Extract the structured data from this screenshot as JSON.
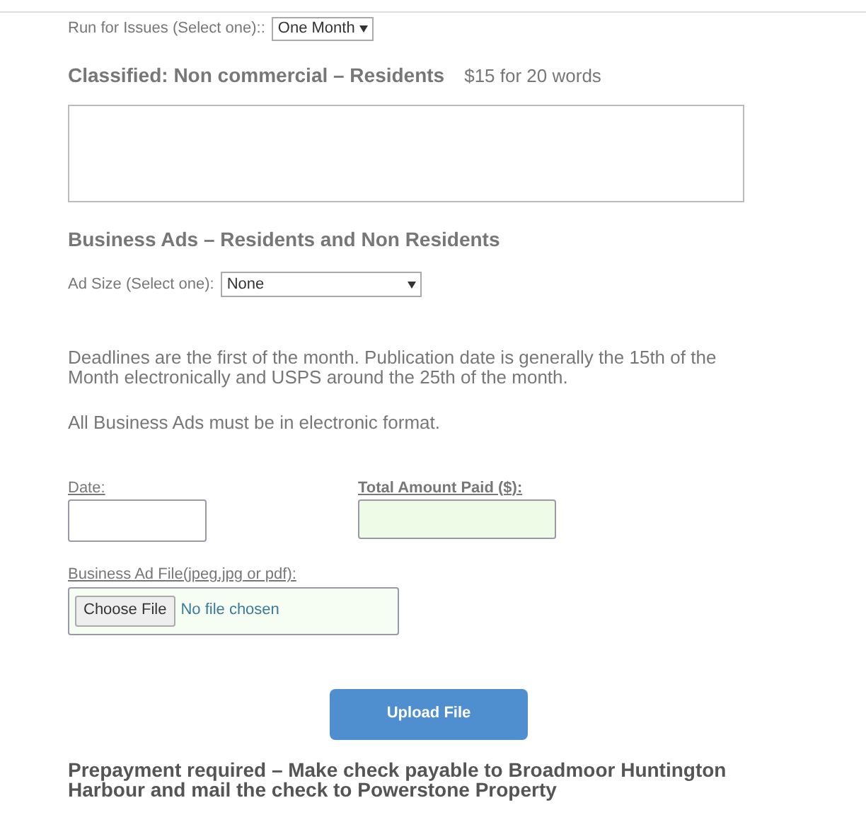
{
  "run_for_issues": {
    "label": "Run for Issues (Select one)::",
    "value": "One Month"
  },
  "classified": {
    "heading": "Classified: Non commercial – Residents",
    "price": "$15 for 20 words"
  },
  "business_ads": {
    "heading": "Business Ads – Residents and Non Residents",
    "ad_size": {
      "label": "Ad Size (Select one):",
      "value": "None"
    }
  },
  "deadline_note": "Deadlines are the first of the month. Publication date is generally the 15th of the Month electronically and USPS around the 25th of the month.",
  "format_note": "All Business Ads must be in electronic format.",
  "date_field": {
    "label": "Date:"
  },
  "amount_field": {
    "label": "Total Amount Paid ($):"
  },
  "file_field": {
    "label": "Business Ad File(jpeg,jpg or pdf):",
    "button": "Choose File",
    "status": "No file chosen"
  },
  "upload_button": "Upload File",
  "prepayment_note": "Prepayment required – Make check payable to Broadmoor Huntington Harbour and mail the check to Powerstone Property"
}
